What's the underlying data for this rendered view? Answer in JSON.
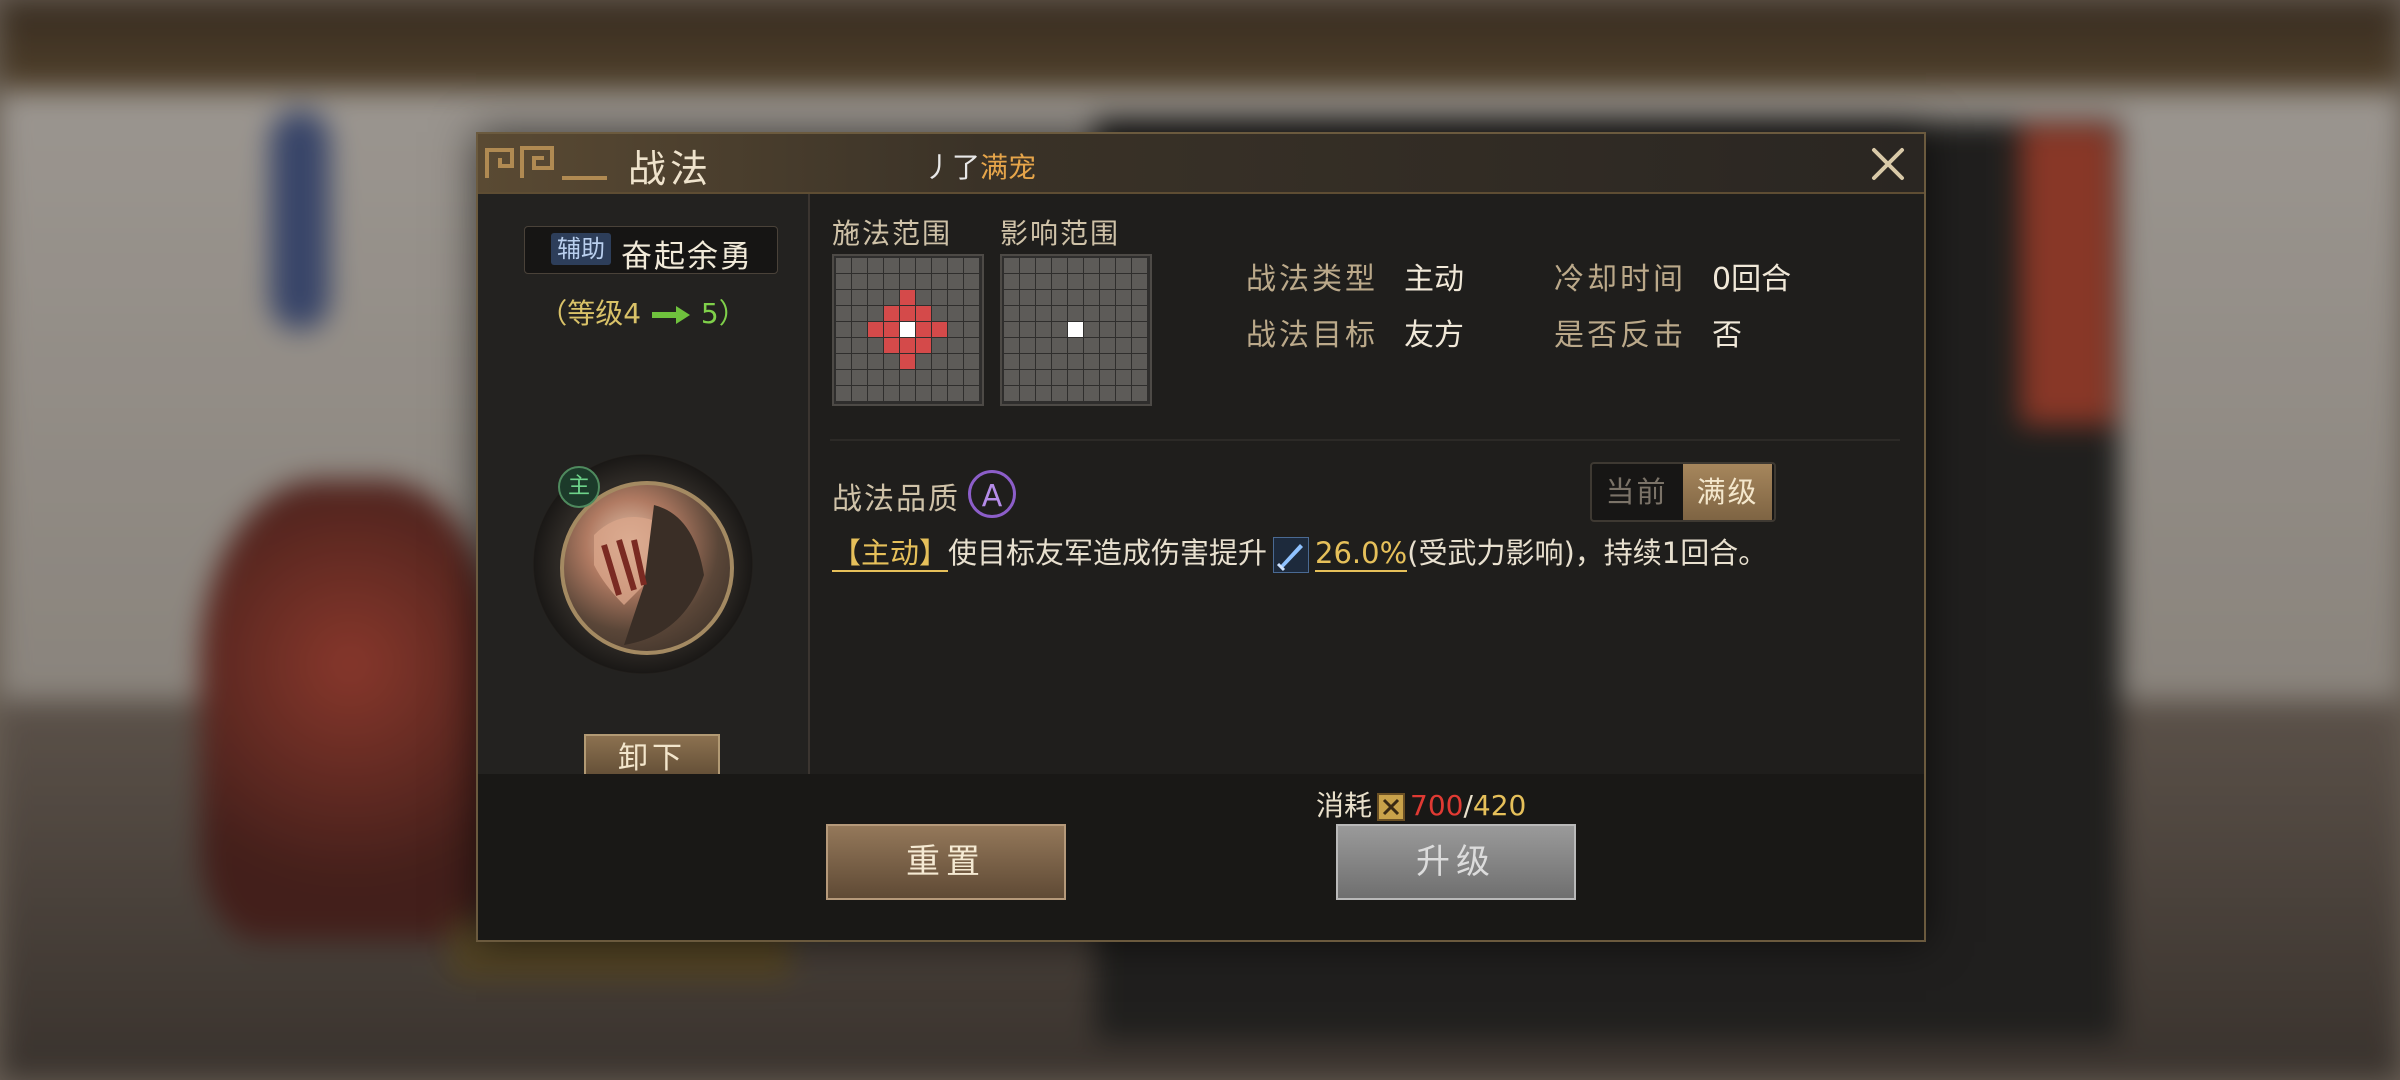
{
  "dialog": {
    "title": "战法",
    "user_prefix": "丿了",
    "user_name": "满宠"
  },
  "skill": {
    "role_badge": "辅助",
    "name": "奋起余勇",
    "level_prefix": "（等级4",
    "level_to": "5）",
    "commander_badge": "主",
    "unequip_label": "卸下"
  },
  "ranges": {
    "cast_label": "施法范围",
    "effect_label": "影响范围"
  },
  "stats": {
    "type_key": "战法类型",
    "type_val": "主动",
    "cooldown_key": "冷却时间",
    "cooldown_val": "0回合",
    "target_key": "战法目标",
    "target_val": "友方",
    "counter_key": "是否反击",
    "counter_val": "否"
  },
  "quality": {
    "label": "战法品质",
    "grade": "A",
    "toggle_current": "当前",
    "toggle_max": "满级"
  },
  "description": {
    "tag": "【主动】",
    "text_a": "使目标友军造成伤害提升",
    "value": "26.0%",
    "text_b": "(受武力影响)，持续1回合。"
  },
  "cost": {
    "label": "消耗",
    "need": "700",
    "sep": "/",
    "have": "420"
  },
  "buttons": {
    "reset": "重置",
    "upgrade": "升级"
  },
  "colors": {
    "accent_gold": "#e6c05a",
    "cost_red": "#e03a33",
    "level_green": "#7fd04a",
    "quality_purple": "#8c5ec9",
    "range_red": "#d44a4a"
  }
}
